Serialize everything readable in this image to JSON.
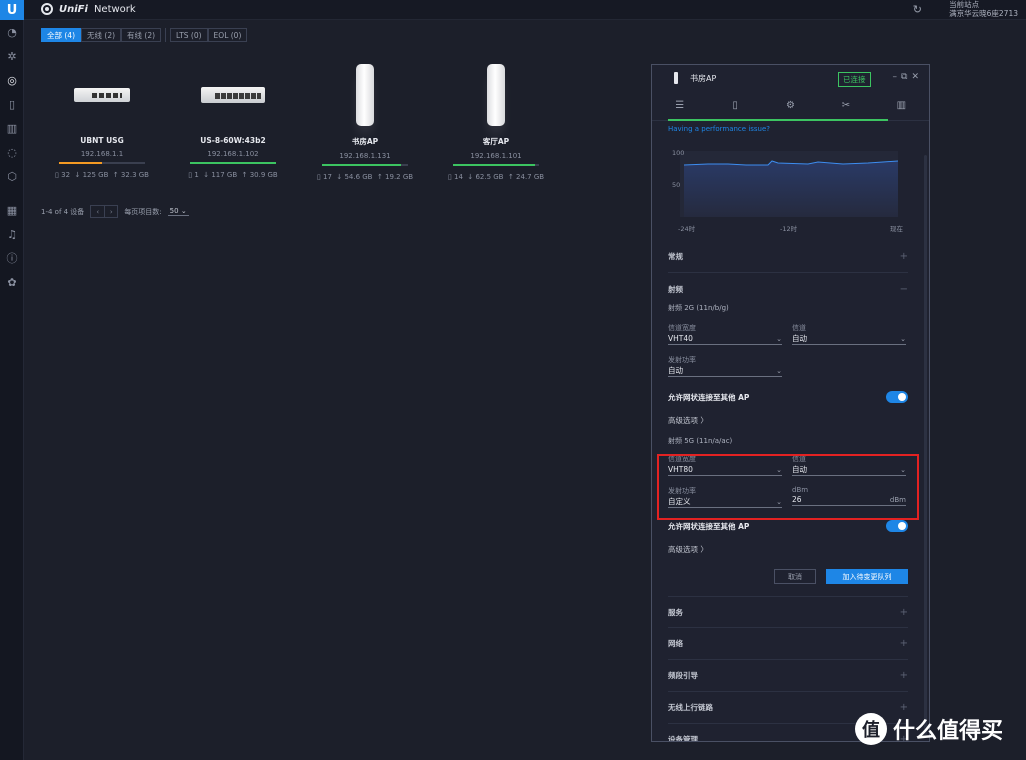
{
  "app": {
    "logo": "U",
    "brand_u": "UniFi",
    "brand_rest": "Network"
  },
  "site": {
    "line1": "当前站点",
    "line2": "满京华云晓6座2713"
  },
  "rail_icons": [
    "dashboard-icon",
    "topology-icon",
    "devices-icon",
    "stats-icon",
    "insights-icon",
    "clients-icon",
    "shield-icon",
    "calendar-icon",
    "bell-icon",
    "help-icon",
    "settings-icon"
  ],
  "filters": {
    "all": "全部 (4)",
    "wireless": "无线 (2)",
    "wired": "有线 (2)",
    "lts": "LTS (0)",
    "eol": "EOL (0)"
  },
  "devices": [
    {
      "name": "UBNT USG",
      "ip": "192.168.1.1",
      "clients": "32",
      "down": "↓ 125 GB",
      "up": "↑ 32.3 GB",
      "bar_color": "#f59a23",
      "bar_fill": 0.5
    },
    {
      "name": "US-8-60W:43b2",
      "ip": "192.168.1.102",
      "clients": "1",
      "down": "↓ 117 GB",
      "up": "↑ 30.9 GB",
      "bar_color": "#3cc461",
      "bar_fill": 1.0
    },
    {
      "name": "书房AP",
      "ip": "192.168.1.131",
      "clients": "17",
      "down": "↓ 54.6 GB",
      "up": "↑ 19.2 GB",
      "bar_color": "#3cc461",
      "bar_fill": 0.92
    },
    {
      "name": "客厅AP",
      "ip": "192.168.1.101",
      "clients": "14",
      "down": "↓ 62.5 GB",
      "up": "↑ 24.7 GB",
      "bar_color": "#3cc461",
      "bar_fill": 0.95
    }
  ],
  "pager": {
    "range": "1-4 of 4 设备",
    "per_page_label": "每页项目数:",
    "per_page": "50"
  },
  "panel": {
    "title": "书房AP",
    "status": "已连接",
    "perf_link": "Having a performance issue?",
    "chart": {
      "y_top": "100",
      "y_mid": "50",
      "x_left": "-24时",
      "x_mid": "-12时",
      "x_right": "现在"
    },
    "sections": {
      "general": "常规",
      "radio": "射频",
      "services": "服务",
      "network": "网络",
      "band_steering": "频段引导",
      "wireless_uplink": "无线上行链路",
      "device_mgmt": "设备管理"
    },
    "radio2g": {
      "title": "射频 2G (11n/b/g)",
      "width_label": "信道宽度",
      "width_value": "VHT40",
      "channel_label": "信道",
      "channel_value": "自动",
      "power_label": "发射功率",
      "power_value": "自动",
      "mesh_label": "允许网状连接至其他 AP",
      "advanced": "高级选项 〉"
    },
    "radio5g": {
      "title": "射频 5G (11n/a/ac)",
      "width_label": "信道宽度",
      "width_value": "VHT80",
      "channel_label": "信道",
      "channel_value": "自动",
      "power_label": "发射功率",
      "power_value": "自定义",
      "dbm_label": "dBm",
      "dbm_value": "26",
      "dbm_unit": "dBm",
      "mesh_label": "允许网状连接至其他 AP",
      "advanced": "高级选项 〉"
    },
    "buttons": {
      "cancel": "取消",
      "queue": "加入待变更队列"
    }
  },
  "watermark": {
    "glyph": "值",
    "text": "什么值得买"
  }
}
